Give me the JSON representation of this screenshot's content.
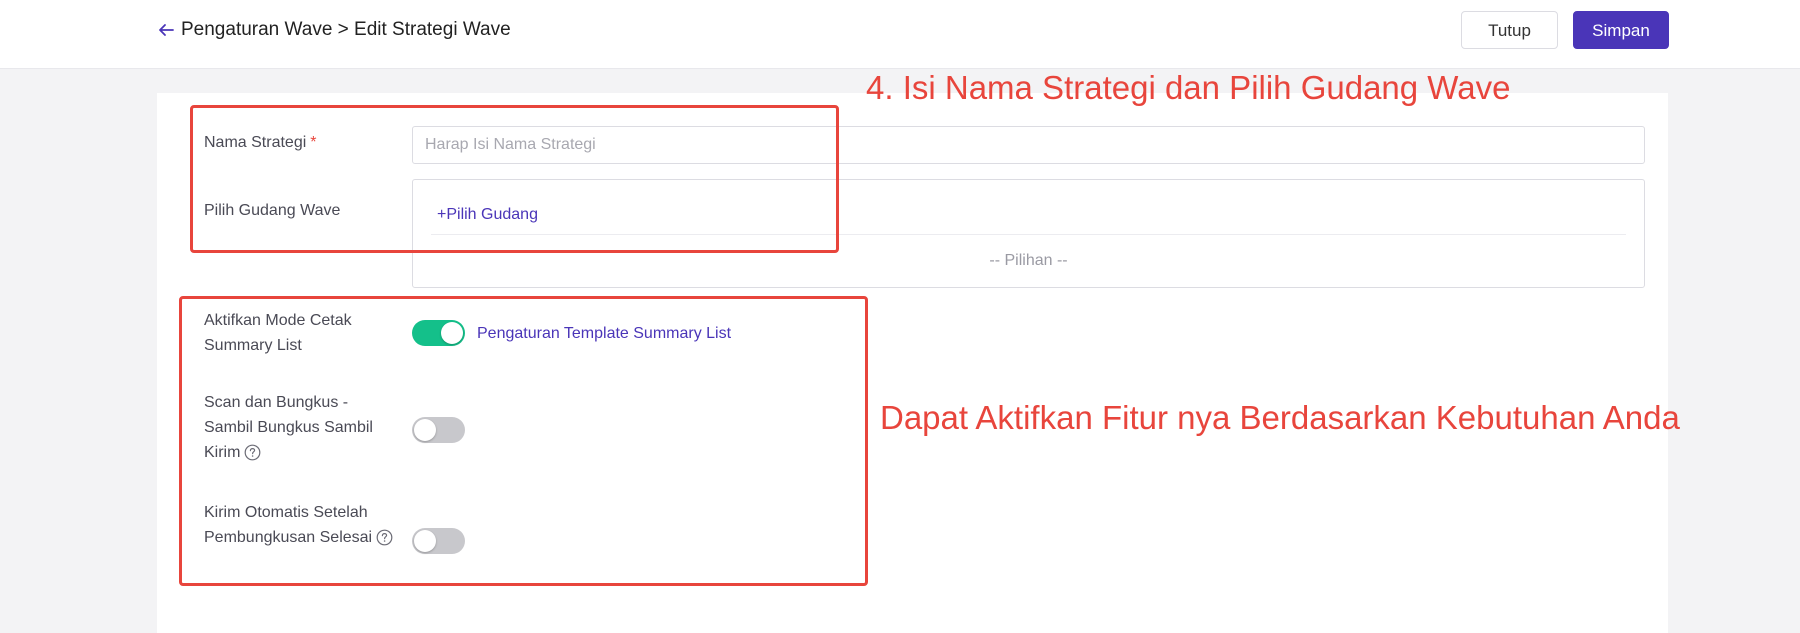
{
  "header": {
    "title": "Pengaturan Wave > Edit Strategi Wave",
    "close_label": "Tutup",
    "save_label": "Simpan"
  },
  "form": {
    "strategy_name": {
      "label": "Nama Strategi",
      "required_mark": "*",
      "placeholder": "Harap Isi Nama Strategi",
      "value": ""
    },
    "warehouse": {
      "label": "Pilih Gudang Wave",
      "add_label": "+Pilih Gudang",
      "empty_label": "-- Pilihan --"
    },
    "toggles": [
      {
        "label": "Aktifkan Mode Cetak Summary List",
        "enabled": true,
        "link_label": "Pengaturan Template Summary List"
      },
      {
        "label": "Scan dan Bungkus - Sambil Bungkus Sambil Kirim",
        "enabled": false,
        "help_icon": "question-circle-icon"
      },
      {
        "label": "Kirim Otomatis Setelah Pembungkusan Selesai",
        "enabled": false,
        "help_icon": "question-circle-icon"
      }
    ]
  },
  "annotations": {
    "step_text": "4. Isi Nama Strategi dan Pilih Gudang Wave",
    "feature_text": "Dapat Aktifkan Fitur nya Berdasarkan Kebutuhan Anda",
    "color": "#e8453c"
  },
  "colors": {
    "primary": "#4a35b8",
    "toggle_on": "#14c08a",
    "toggle_off": "#c8c8cc"
  }
}
